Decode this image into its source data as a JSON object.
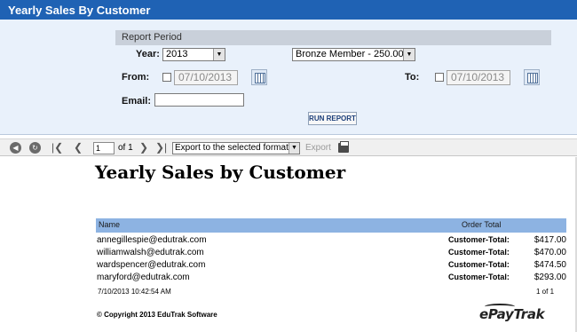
{
  "window": {
    "title": "Yearly Sales By Customer"
  },
  "params": {
    "section_label": "Report Period",
    "year_label": "Year:",
    "year_value": "2013",
    "membership_value": "Bronze Member - 250.00",
    "from_label": "From:",
    "from_date": "07/10/2013",
    "to_label": "To:",
    "to_date": "07/10/2013",
    "email_label": "Email:",
    "email_value": "",
    "run_label": "RUN REPORT"
  },
  "toolbar": {
    "page_value": "1",
    "of_label": "of 1",
    "export_format": "Export to the selected format",
    "export_label": "Export"
  },
  "report": {
    "title": "Yearly Sales by Customer",
    "col_name": "Name",
    "col_total": "Order Total",
    "rows": [
      {
        "email": "annegillespie@edutrak.com",
        "label": "Customer-Total:",
        "amount": "$417.00"
      },
      {
        "email": "williamwalsh@edutrak.com",
        "label": "Customer-Total:",
        "amount": "$470.00"
      },
      {
        "email": "wardspencer@edutrak.com",
        "label": "Customer-Total:",
        "amount": "$474.50"
      },
      {
        "email": "maryford@edutrak.com",
        "label": "Customer-Total:",
        "amount": "$293.00"
      }
    ],
    "timestamp": "7/10/2013 10:42:54 AM",
    "page_count": "1 of 1",
    "copyright": "© Copyright 2013 EduTrak Software",
    "logo": "ePayTrak"
  }
}
